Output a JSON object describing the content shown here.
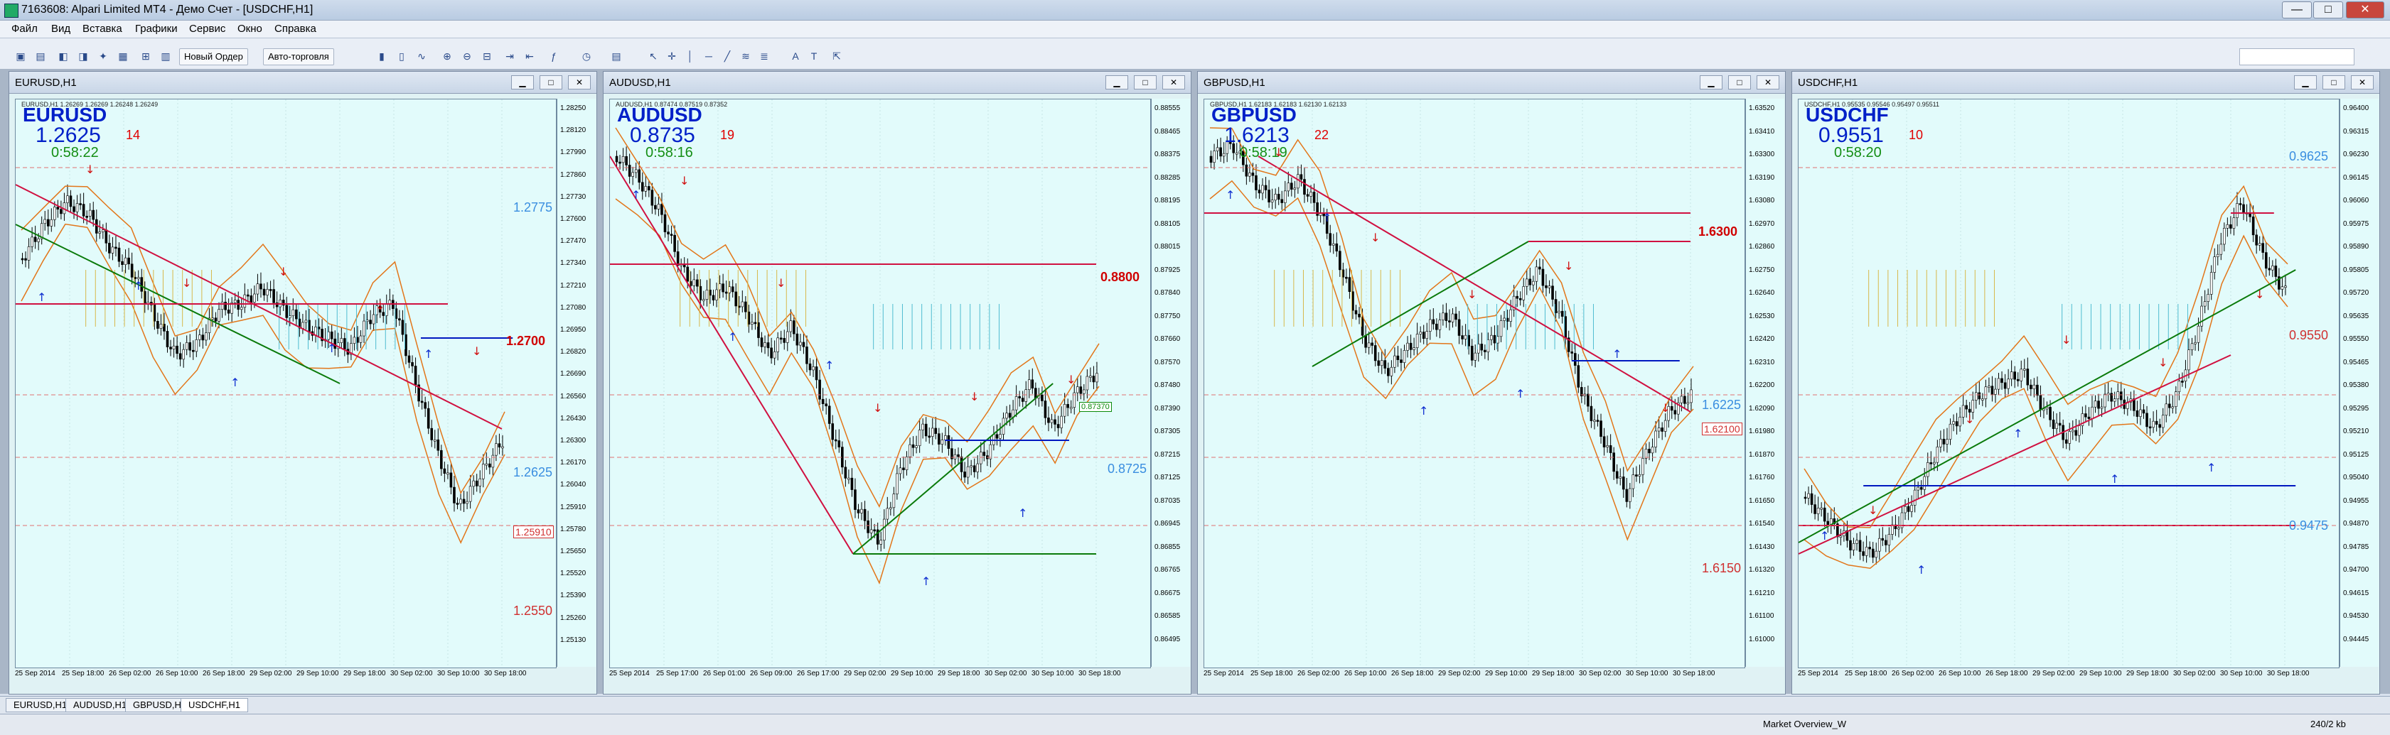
{
  "window": {
    "title": "7163608: Alpari Limited MT4 - Демо Счет - [USDCHF,H1]",
    "min": "—",
    "max": "□",
    "close": "✕"
  },
  "menu": [
    "Файл",
    "Вид",
    "Вставка",
    "Графики",
    "Сервис",
    "Окно",
    "Справка"
  ],
  "toolbar": {
    "new_order": "Новый Ордер",
    "autotrade": "Авто-торговля"
  },
  "charts": [
    {
      "title": "EURUSD,H1",
      "symbol": "EURUSD",
      "info": "EURUSD,H1 1.26269 1.26269 1.26248 1.26249",
      "price": "1.2625",
      "spread": "14",
      "timer": "0:58:22",
      "level_red": "1.2700",
      "label_mid": "1.2775",
      "label_low": "1.2625",
      "label_box": "1.25910",
      "label_bottom": "1.2550",
      "axis": [
        "1.28250",
        "1.28120",
        "1.27990",
        "1.27860",
        "1.27730",
        "1.27600",
        "1.27470",
        "1.27340",
        "1.27210",
        "1.27080",
        "1.26950",
        "1.26820",
        "1.26690",
        "1.26560",
        "1.26430",
        "1.26300",
        "1.26170",
        "1.26040",
        "1.25910",
        "1.25780",
        "1.25650",
        "1.25520",
        "1.25390",
        "1.25260",
        "1.25130"
      ],
      "times": [
        "25 Sep 2014",
        "25 Sep 18:00",
        "26 Sep 02:00",
        "26 Sep 10:00",
        "26 Sep 18:00",
        "29 Sep 02:00",
        "29 Sep 10:00",
        "29 Sep 18:00",
        "30 Sep 02:00",
        "30 Sep 10:00",
        "30 Sep 18:00"
      ]
    },
    {
      "title": "AUDUSD,H1",
      "symbol": "AUDUSD",
      "info": "AUDUSD,H1 0.87474 0.87519 0.87352",
      "price": "0.8735",
      "spread": "19",
      "timer": "0:58:16",
      "level_red": "0.8800",
      "label_mid": "0.87370",
      "label_low": "0.8725",
      "label_box": "",
      "label_bottom": "",
      "axis": [
        "0.88555",
        "0.88465",
        "0.88375",
        "0.88285",
        "0.88195",
        "0.88105",
        "0.88015",
        "0.87925",
        "0.87840",
        "0.87750",
        "0.87660",
        "0.87570",
        "0.87480",
        "0.87390",
        "0.87305",
        "0.87215",
        "0.87125",
        "0.87035",
        "0.86945",
        "0.86855",
        "0.86765",
        "0.86675",
        "0.86585",
        "0.86495"
      ],
      "times": [
        "25 Sep 2014",
        "25 Sep 17:00",
        "26 Sep 01:00",
        "26 Sep 09:00",
        "26 Sep 17:00",
        "29 Sep 02:00",
        "29 Sep 10:00",
        "29 Sep 18:00",
        "30 Sep 02:00",
        "30 Sep 10:00",
        "30 Sep 18:00"
      ]
    },
    {
      "title": "GBPUSD,H1",
      "symbol": "GBPUSD",
      "info": "GBPUSD,H1 1.62183 1.62183 1.62130 1.62133",
      "price": "1.6213",
      "spread": "22",
      "timer": "0:58:19",
      "level_red": "1.6300",
      "label_mid": "1.6225",
      "label_low": "1.62100",
      "label_box": "",
      "label_bottom": "1.6150",
      "axis": [
        "1.63520",
        "1.63410",
        "1.63300",
        "1.63190",
        "1.63080",
        "1.62970",
        "1.62860",
        "1.62750",
        "1.62640",
        "1.62530",
        "1.62420",
        "1.62310",
        "1.62200",
        "1.62090",
        "1.61980",
        "1.61870",
        "1.61760",
        "1.61650",
        "1.61540",
        "1.61430",
        "1.61320",
        "1.61210",
        "1.61100",
        "1.61000"
      ],
      "times": [
        "25 Sep 2014",
        "25 Sep 18:00",
        "26 Sep 02:00",
        "26 Sep 10:00",
        "26 Sep 18:00",
        "29 Sep 02:00",
        "29 Sep 10:00",
        "29 Sep 18:00",
        "30 Sep 02:00",
        "30 Sep 10:00",
        "30 Sep 18:00"
      ]
    },
    {
      "title": "USDCHF,H1",
      "symbol": "USDCHF",
      "info": "USDCHF,H1 0.95535 0.95546 0.95497 0.95511",
      "price": "0.9551",
      "spread": "10",
      "timer": "0:58:20",
      "level_red": "",
      "label_mid": "0.9625",
      "label_low": "0.9475",
      "label_box": "0.9550",
      "label_bottom": "",
      "axis": [
        "0.96400",
        "0.96315",
        "0.96230",
        "0.96145",
        "0.96060",
        "0.95975",
        "0.95890",
        "0.95805",
        "0.95720",
        "0.95635",
        "0.95550",
        "0.95465",
        "0.95380",
        "0.95295",
        "0.95210",
        "0.95125",
        "0.95040",
        "0.94955",
        "0.94870",
        "0.94785",
        "0.94700",
        "0.94615",
        "0.94530",
        "0.94445"
      ],
      "times": [
        "25 Sep 2014",
        "25 Sep 18:00",
        "26 Sep 02:00",
        "26 Sep 10:00",
        "26 Sep 18:00",
        "29 Sep 02:00",
        "29 Sep 10:00",
        "29 Sep 18:00",
        "30 Sep 02:00",
        "30 Sep 10:00",
        "30 Sep 18:00"
      ]
    }
  ],
  "tabs": [
    "EURUSD,H1",
    "AUDUSD,H1",
    "GBPUSD,H1",
    "USDCHF,H1"
  ],
  "status": {
    "market": "Market Overview_W",
    "traffic": "240/2 kb"
  }
}
